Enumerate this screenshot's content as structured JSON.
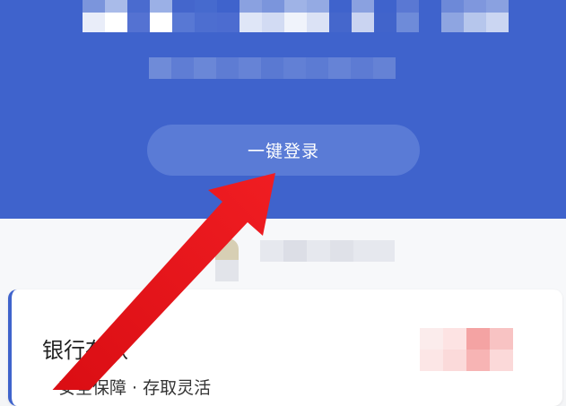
{
  "header": {
    "login_button_label": "一键登录"
  },
  "card": {
    "title": "银行存款",
    "subtitle": "安全保障 · 存取灵活"
  },
  "colors": {
    "header_bg": "#3f63cc",
    "button_bg": "#5a7bd6",
    "arrow": "#e8151b"
  }
}
